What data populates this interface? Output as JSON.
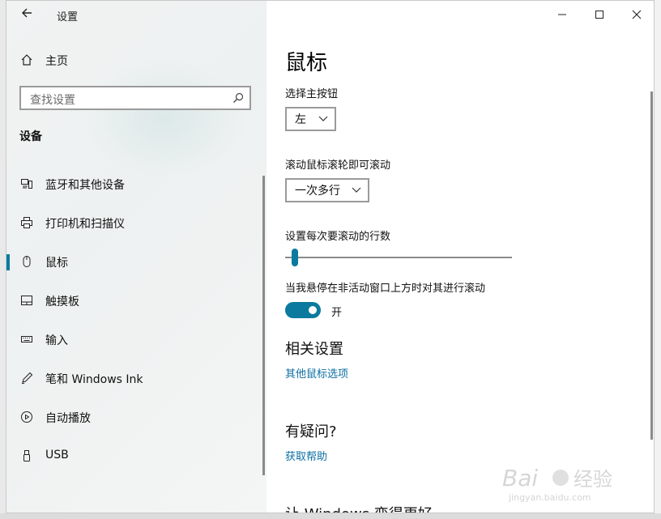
{
  "window": {
    "title": "设置",
    "back_icon": "arrow-left-icon",
    "controls": {
      "minimize": "—",
      "maximize": "☐",
      "close": "✕"
    }
  },
  "sidebar": {
    "home_label": "主页",
    "search_placeholder": "查找设置",
    "section_title": "设备",
    "items": [
      {
        "label": "蓝牙和其他设备",
        "icon": "bluetooth-devices-icon",
        "active": false
      },
      {
        "label": "打印机和扫描仪",
        "icon": "printer-icon",
        "active": false
      },
      {
        "label": "鼠标",
        "icon": "mouse-icon",
        "active": true
      },
      {
        "label": "触摸板",
        "icon": "touchpad-icon",
        "active": false
      },
      {
        "label": "输入",
        "icon": "keyboard-icon",
        "active": false
      },
      {
        "label": "笔和 Windows Ink",
        "icon": "pen-icon",
        "active": false
      },
      {
        "label": "自动播放",
        "icon": "autoplay-icon",
        "active": false
      },
      {
        "label": "USB",
        "icon": "usb-icon",
        "active": false
      }
    ]
  },
  "main": {
    "title": "鼠标",
    "primary_button_label": "选择主按钮",
    "primary_button_value": "左",
    "scroll_wheel_label": "滚动鼠标滚轮即可滚动",
    "scroll_wheel_value": "一次多行",
    "lines_label": "设置每次要滚动的行数",
    "lines_slider_fraction": 0.03,
    "inactive_scroll_label": "当我悬停在非活动窗口上方时对其进行滚动",
    "inactive_scroll_state": "开",
    "related_title": "相关设置",
    "related_link": "其他鼠标选项",
    "question_title": "有疑问?",
    "help_link": "获取帮助",
    "better_title": "让 Windows 变得更好"
  },
  "colors": {
    "accent": "#0b7a9e",
    "link": "#0b6fa3"
  }
}
